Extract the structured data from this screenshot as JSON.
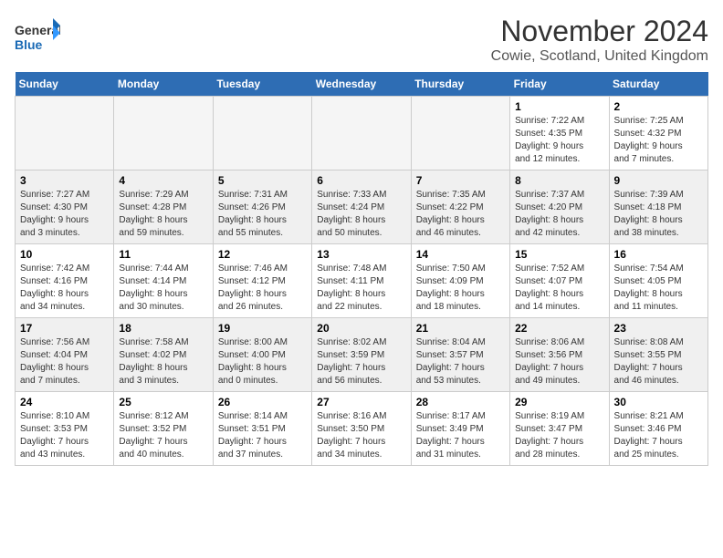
{
  "header": {
    "logo_line1": "General",
    "logo_line2": "Blue",
    "title": "November 2024",
    "subtitle": "Cowie, Scotland, United Kingdom"
  },
  "calendar": {
    "headers": [
      "Sunday",
      "Monday",
      "Tuesday",
      "Wednesday",
      "Thursday",
      "Friday",
      "Saturday"
    ],
    "weeks": [
      [
        {
          "day": "",
          "info": ""
        },
        {
          "day": "",
          "info": ""
        },
        {
          "day": "",
          "info": ""
        },
        {
          "day": "",
          "info": ""
        },
        {
          "day": "",
          "info": ""
        },
        {
          "day": "1",
          "info": "Sunrise: 7:22 AM\nSunset: 4:35 PM\nDaylight: 9 hours\nand 12 minutes."
        },
        {
          "day": "2",
          "info": "Sunrise: 7:25 AM\nSunset: 4:32 PM\nDaylight: 9 hours\nand 7 minutes."
        }
      ],
      [
        {
          "day": "3",
          "info": "Sunrise: 7:27 AM\nSunset: 4:30 PM\nDaylight: 9 hours\nand 3 minutes."
        },
        {
          "day": "4",
          "info": "Sunrise: 7:29 AM\nSunset: 4:28 PM\nDaylight: 8 hours\nand 59 minutes."
        },
        {
          "day": "5",
          "info": "Sunrise: 7:31 AM\nSunset: 4:26 PM\nDaylight: 8 hours\nand 55 minutes."
        },
        {
          "day": "6",
          "info": "Sunrise: 7:33 AM\nSunset: 4:24 PM\nDaylight: 8 hours\nand 50 minutes."
        },
        {
          "day": "7",
          "info": "Sunrise: 7:35 AM\nSunset: 4:22 PM\nDaylight: 8 hours\nand 46 minutes."
        },
        {
          "day": "8",
          "info": "Sunrise: 7:37 AM\nSunset: 4:20 PM\nDaylight: 8 hours\nand 42 minutes."
        },
        {
          "day": "9",
          "info": "Sunrise: 7:39 AM\nSunset: 4:18 PM\nDaylight: 8 hours\nand 38 minutes."
        }
      ],
      [
        {
          "day": "10",
          "info": "Sunrise: 7:42 AM\nSunset: 4:16 PM\nDaylight: 8 hours\nand 34 minutes."
        },
        {
          "day": "11",
          "info": "Sunrise: 7:44 AM\nSunset: 4:14 PM\nDaylight: 8 hours\nand 30 minutes."
        },
        {
          "day": "12",
          "info": "Sunrise: 7:46 AM\nSunset: 4:12 PM\nDaylight: 8 hours\nand 26 minutes."
        },
        {
          "day": "13",
          "info": "Sunrise: 7:48 AM\nSunset: 4:11 PM\nDaylight: 8 hours\nand 22 minutes."
        },
        {
          "day": "14",
          "info": "Sunrise: 7:50 AM\nSunset: 4:09 PM\nDaylight: 8 hours\nand 18 minutes."
        },
        {
          "day": "15",
          "info": "Sunrise: 7:52 AM\nSunset: 4:07 PM\nDaylight: 8 hours\nand 14 minutes."
        },
        {
          "day": "16",
          "info": "Sunrise: 7:54 AM\nSunset: 4:05 PM\nDaylight: 8 hours\nand 11 minutes."
        }
      ],
      [
        {
          "day": "17",
          "info": "Sunrise: 7:56 AM\nSunset: 4:04 PM\nDaylight: 8 hours\nand 7 minutes."
        },
        {
          "day": "18",
          "info": "Sunrise: 7:58 AM\nSunset: 4:02 PM\nDaylight: 8 hours\nand 3 minutes."
        },
        {
          "day": "19",
          "info": "Sunrise: 8:00 AM\nSunset: 4:00 PM\nDaylight: 8 hours\nand 0 minutes."
        },
        {
          "day": "20",
          "info": "Sunrise: 8:02 AM\nSunset: 3:59 PM\nDaylight: 7 hours\nand 56 minutes."
        },
        {
          "day": "21",
          "info": "Sunrise: 8:04 AM\nSunset: 3:57 PM\nDaylight: 7 hours\nand 53 minutes."
        },
        {
          "day": "22",
          "info": "Sunrise: 8:06 AM\nSunset: 3:56 PM\nDaylight: 7 hours\nand 49 minutes."
        },
        {
          "day": "23",
          "info": "Sunrise: 8:08 AM\nSunset: 3:55 PM\nDaylight: 7 hours\nand 46 minutes."
        }
      ],
      [
        {
          "day": "24",
          "info": "Sunrise: 8:10 AM\nSunset: 3:53 PM\nDaylight: 7 hours\nand 43 minutes."
        },
        {
          "day": "25",
          "info": "Sunrise: 8:12 AM\nSunset: 3:52 PM\nDaylight: 7 hours\nand 40 minutes."
        },
        {
          "day": "26",
          "info": "Sunrise: 8:14 AM\nSunset: 3:51 PM\nDaylight: 7 hours\nand 37 minutes."
        },
        {
          "day": "27",
          "info": "Sunrise: 8:16 AM\nSunset: 3:50 PM\nDaylight: 7 hours\nand 34 minutes."
        },
        {
          "day": "28",
          "info": "Sunrise: 8:17 AM\nSunset: 3:49 PM\nDaylight: 7 hours\nand 31 minutes."
        },
        {
          "day": "29",
          "info": "Sunrise: 8:19 AM\nSunset: 3:47 PM\nDaylight: 7 hours\nand 28 minutes."
        },
        {
          "day": "30",
          "info": "Sunrise: 8:21 AM\nSunset: 3:46 PM\nDaylight: 7 hours\nand 25 minutes."
        }
      ]
    ]
  }
}
